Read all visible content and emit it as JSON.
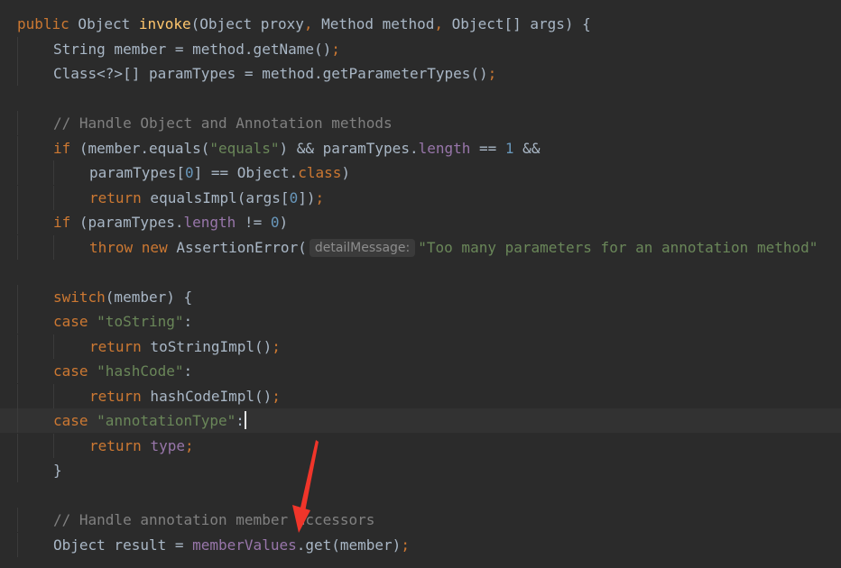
{
  "editor": {
    "theme_colors": {
      "background": "#2b2b2b",
      "current_line": "#323232",
      "keyword": "#cc7832",
      "string": "#6a8759",
      "number": "#6897bb",
      "comment": "#808080",
      "field": "#9876aa",
      "function_decl": "#ffc66d",
      "default_text": "#a9b7c6",
      "annotation_arrow": "#f0352a"
    },
    "lines": [
      {
        "t": [
          [
            "kw",
            "public"
          ],
          [
            "p",
            " Object "
          ],
          [
            "fn",
            "invoke"
          ],
          [
            "p",
            "(Object proxy"
          ],
          [
            "kw",
            ","
          ],
          [
            "p",
            " Method method"
          ],
          [
            "kw",
            ","
          ],
          [
            "p",
            " Object[] args) {"
          ]
        ]
      },
      {
        "t": [
          [
            "p",
            "String member = method.getName()"
          ],
          [
            "kw",
            ";"
          ]
        ]
      },
      {
        "t": [
          [
            "p",
            "Class<?>[] paramTypes = method.getParameterTypes()"
          ],
          [
            "kw",
            ";"
          ]
        ]
      },
      {
        "t": []
      },
      {
        "t": [
          [
            "cmt",
            "// Handle Object and Annotation methods"
          ]
        ]
      },
      {
        "t": [
          [
            "kw",
            "if"
          ],
          [
            "p",
            " (member.equals("
          ],
          [
            "str",
            "\"equals\""
          ],
          [
            "p",
            ") && paramTypes."
          ],
          [
            "fld",
            "length"
          ],
          [
            "p",
            " == "
          ],
          [
            "num",
            "1"
          ],
          [
            "p",
            " &&"
          ]
        ]
      },
      {
        "t": [
          [
            "p",
            "paramTypes["
          ],
          [
            "num",
            "0"
          ],
          [
            "p",
            "] == Object."
          ],
          [
            "kw",
            "class"
          ],
          [
            "p",
            ")"
          ]
        ]
      },
      {
        "t": [
          [
            "kw",
            "return"
          ],
          [
            "p",
            " equalsImpl(args["
          ],
          [
            "num",
            "0"
          ],
          [
            "p",
            "])"
          ],
          [
            "kw",
            ";"
          ]
        ]
      },
      {
        "t": [
          [
            "kw",
            "if"
          ],
          [
            "p",
            " (paramTypes."
          ],
          [
            "fld",
            "length"
          ],
          [
            "p",
            " != "
          ],
          [
            "num",
            "0"
          ],
          [
            "p",
            ")"
          ]
        ]
      },
      {
        "t": [
          [
            "kw",
            "throw new"
          ],
          [
            "p",
            " AssertionError("
          ],
          [
            "hint",
            "detailMessage:"
          ],
          [
            "str",
            "\"Too many parameters for an annotation method\""
          ]
        ]
      },
      {
        "t": []
      },
      {
        "t": [
          [
            "kw",
            "switch"
          ],
          [
            "p",
            "(member) {"
          ]
        ]
      },
      {
        "t": [
          [
            "kw",
            "case"
          ],
          [
            "p",
            " "
          ],
          [
            "str",
            "\"toString\""
          ],
          [
            "p",
            ":"
          ]
        ]
      },
      {
        "t": [
          [
            "kw",
            "return"
          ],
          [
            "p",
            " toStringImpl()"
          ],
          [
            "kw",
            ";"
          ]
        ]
      },
      {
        "t": [
          [
            "kw",
            "case"
          ],
          [
            "p",
            " "
          ],
          [
            "str",
            "\"hashCode\""
          ],
          [
            "p",
            ":"
          ]
        ]
      },
      {
        "t": [
          [
            "kw",
            "return"
          ],
          [
            "p",
            " hashCodeImpl()"
          ],
          [
            "kw",
            ";"
          ]
        ]
      },
      {
        "t": [
          [
            "kw",
            "case"
          ],
          [
            "p",
            " "
          ],
          [
            "str",
            "\"annotationType\""
          ],
          [
            "p",
            ":"
          ],
          [
            "caret",
            ""
          ]
        ]
      },
      {
        "t": [
          [
            "kw",
            "return"
          ],
          [
            "p",
            " "
          ],
          [
            "fld",
            "type"
          ],
          [
            "kw",
            ";"
          ]
        ]
      },
      {
        "t": [
          [
            "p",
            "}"
          ]
        ]
      },
      {
        "t": []
      },
      {
        "t": [
          [
            "cmt",
            "// Handle annotation member accessors"
          ]
        ]
      },
      {
        "t": [
          [
            "p",
            "Object result = "
          ],
          [
            "fld",
            "memberValues"
          ],
          [
            "p",
            ".get(member)"
          ],
          [
            "kw",
            ";"
          ]
        ]
      }
    ]
  }
}
